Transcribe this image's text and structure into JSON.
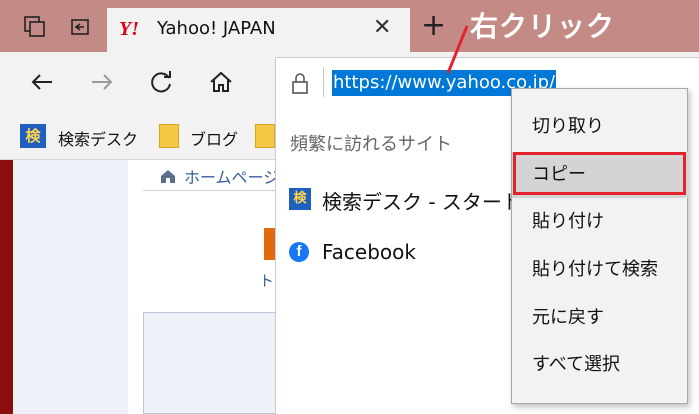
{
  "tab": {
    "title": "Yahoo! JAPAN",
    "favicon_text": "Y!",
    "close_glyph": "✕"
  },
  "new_tab_glyph": "+",
  "annotation": {
    "text": "右クリック",
    "color": "#ffffff"
  },
  "address_bar": {
    "url": "https://www.yahoo.co.jp/"
  },
  "favorites": {
    "items": [
      {
        "icon_text": "検",
        "label": "検索デスク"
      },
      {
        "label": "ブログ"
      }
    ]
  },
  "page": {
    "breadcrumb": "ホームページ",
    "partial_text": "ト"
  },
  "dropdown": {
    "header": "頻繁に訪れるサイト",
    "items": [
      {
        "icon_text": "検",
        "label": "検索デスク - スタート"
      },
      {
        "icon_text": "f",
        "label": "Facebook"
      }
    ]
  },
  "context_menu": {
    "items": [
      "切り取り",
      "コピー",
      "貼り付け",
      "貼り付けて検索",
      "元に戻す",
      "すべて選択"
    ],
    "highlighted": "コピー",
    "highlight_color": "#e3222b"
  },
  "colors": {
    "titlebar": "#c48a86",
    "frame": "#8b0d0d",
    "selection": "#0078d7"
  }
}
